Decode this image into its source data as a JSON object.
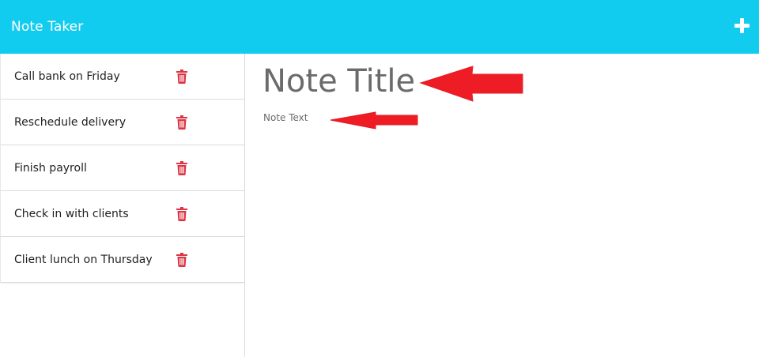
{
  "navbar": {
    "title": "Note Taker",
    "add_icon": "plus-icon",
    "background": "#11ccef"
  },
  "notes": [
    {
      "title": "Call bank on Friday"
    },
    {
      "title": "Reschedule delivery"
    },
    {
      "title": "Finish payroll"
    },
    {
      "title": "Check in with clients"
    },
    {
      "title": "Client lunch on Thursday"
    }
  ],
  "delete_icon": "trash-icon",
  "delete_color": "#dc3545",
  "editor": {
    "title_placeholder": "Note Title",
    "text_placeholder": "Note Text"
  },
  "annotations": {
    "arrow_color": "#ee1c25",
    "icon": "arrow-left-icon"
  }
}
